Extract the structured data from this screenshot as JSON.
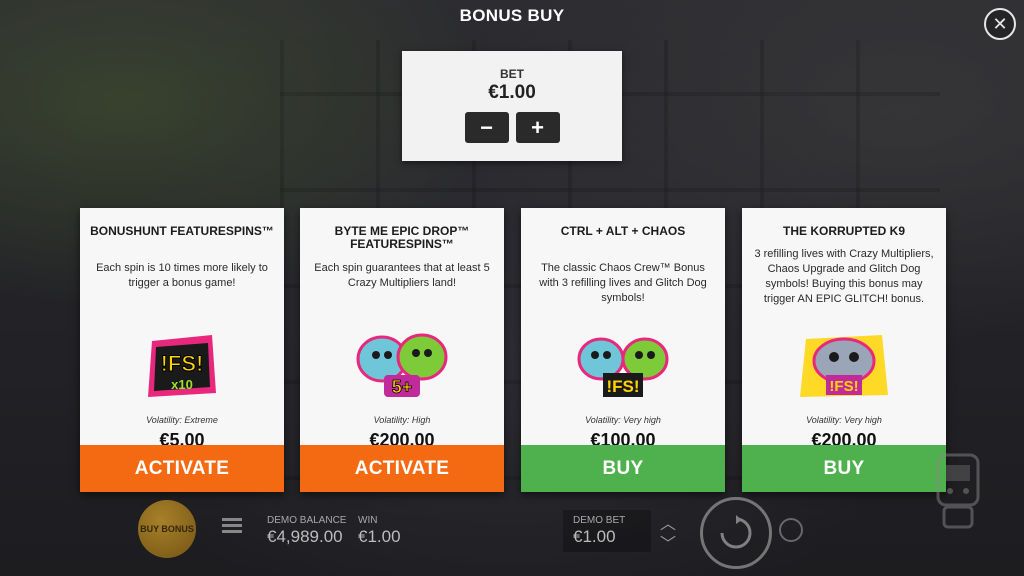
{
  "dialog": {
    "title": "BONUS BUY",
    "close_icon": "close-icon"
  },
  "bet": {
    "label": "BET",
    "value": "€1.00",
    "minus": "−",
    "plus": "+"
  },
  "cards": [
    {
      "title": "BONUSHUNT FEATURESPINS™",
      "description": "Each spin is 10 times more likely to trigger a bonus game!",
      "art_text": "!FS!",
      "art_sub": "x10",
      "volatility": "Volatility: Extreme",
      "price": "€5.00",
      "action": "ACTIVATE",
      "action_color": "#f46a13"
    },
    {
      "title": "BYTE ME EPIC DROP™ FEATURESPINS™",
      "description": "Each spin guarantees that at least 5 Crazy Multipliers land!",
      "art_text": "5+",
      "volatility": "Volatility: High",
      "price": "€200.00",
      "action": "ACTIVATE",
      "action_color": "#f46a13"
    },
    {
      "title": "CTRL + ALT + CHAOS",
      "description": "The classic Chaos Crew™ Bonus with 3 refilling lives and Glitch Dog symbols!",
      "art_text": "!FS!",
      "volatility": "Volatility: Very high",
      "price": "€100.00",
      "action": "BUY",
      "action_color": "#4fb14d"
    },
    {
      "title": "THE KORRUPTED K9",
      "description": "3 refilling lives with Crazy Multipliers, Chaos Upgrade and Glitch Dog symbols! Buying this bonus may trigger AN EPIC GLITCH! bonus.",
      "art_text": "!FS!",
      "volatility": "Volatility: Very high",
      "price": "€200.00",
      "action": "BUY",
      "action_color": "#4fb14d"
    }
  ],
  "footer": {
    "buy_bonus": "BUY BONUS",
    "demo_balance_label": "DEMO BALANCE",
    "demo_balance_value": "€4,989.00",
    "win_label": "WIN",
    "win_value": "€1.00",
    "demo_bet_label": "DEMO BET",
    "demo_bet_value": "€1.00"
  }
}
